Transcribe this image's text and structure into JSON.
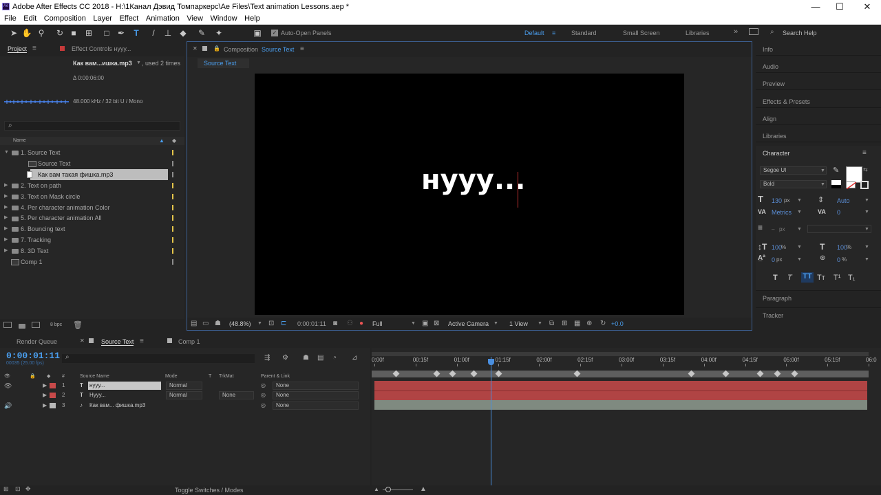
{
  "window": {
    "title": "Adobe After Effects CC 2018 - H:\\1Канал Дэвид Томпаркерс\\Ae Files\\Text animation Lessons.aep *",
    "app_icon": "Ae",
    "minimize": "—",
    "maximize": "☐",
    "close": "✕"
  },
  "menu": [
    "File",
    "Edit",
    "Composition",
    "Layer",
    "Effect",
    "Animation",
    "View",
    "Window",
    "Help"
  ],
  "toolbar": {
    "auto_open_panels": "Auto-Open Panels",
    "workspaces": [
      "Default",
      "Standard",
      "Small Screen",
      "Libraries"
    ],
    "active_workspace": "Default",
    "search_help": "Search Help",
    "more": "»"
  },
  "project_panel": {
    "tab_project": "Project",
    "tab_effect_controls": "Effect Controls нууу...",
    "file_name": "Как вам...ишка.mp3",
    "used": ", used 2 times",
    "duration": "Δ 0:00:06:00",
    "audio_info": "48.000 kHz / 32 bit U / Mono",
    "search_icon": "⌕",
    "column_name": "Name",
    "bpc": "8 bpc",
    "items": [
      {
        "label": "1. Source Text",
        "type": "folder",
        "open": true,
        "indent": 0
      },
      {
        "label": "Source Text",
        "type": "comp",
        "indent": 1
      },
      {
        "label": "Как вам такая фишка.mp3",
        "type": "audio",
        "indent": 1,
        "selected": true
      },
      {
        "label": "2. Text on path",
        "type": "folder",
        "indent": 0
      },
      {
        "label": "3. Text on Mask circle",
        "type": "folder",
        "indent": 0
      },
      {
        "label": "4. Per character animation Color",
        "type": "folder",
        "indent": 0
      },
      {
        "label": "5. Per character animation All",
        "type": "folder",
        "indent": 0
      },
      {
        "label": "6. Bouncing text",
        "type": "folder",
        "indent": 0
      },
      {
        "label": "7. Tracking",
        "type": "folder",
        "indent": 0
      },
      {
        "label": "8. 3D Text",
        "type": "folder",
        "indent": 0
      },
      {
        "label": "Comp 1",
        "type": "comp",
        "indent": 0
      }
    ]
  },
  "composition_panel": {
    "tab_prefix": "Composition",
    "tab_name": "Source Text",
    "subtab": "Source Text",
    "canvas_text": "нууу...",
    "zoom": "(48.8%)",
    "timecode": "0:00:01:11",
    "resolution": "Full",
    "camera": "Active Camera",
    "view": "1 View",
    "exposure": "+0.0"
  },
  "right_panel": {
    "tabs": [
      "Info",
      "Audio",
      "Preview",
      "Effects & Presets",
      "Align",
      "Libraries",
      "Character"
    ],
    "bottom_tabs": [
      "Paragraph",
      "Tracker"
    ],
    "font_family": "Segoe UI",
    "font_style": "Bold",
    "font_size": "130",
    "font_size_unit": "px",
    "leading": "Auto",
    "kerning": "Metrics",
    "tracking": "0",
    "stroke_width": "–",
    "stroke_unit": "px",
    "vert_scale": "100",
    "horiz_scale": "100",
    "baseline_shift": "0",
    "baseline_unit": "px",
    "tsume": "0",
    "percent": "%",
    "style_buttons": [
      "T",
      "T",
      "TT",
      "Tт",
      "T¹",
      "T₁"
    ],
    "fill_color": "#ffffff",
    "stroke_color": "#000000"
  },
  "timeline": {
    "tab_render_queue": "Render Queue",
    "tab_active": "Source Text",
    "tab_comp1": "Comp 1",
    "timecode": "0:00:01:11",
    "fps": "00035 (25.00 fps)",
    "col_source_name": "Source Name",
    "col_mode": "Mode",
    "col_t": "T",
    "col_trkmat": "TrkMat",
    "col_parent": "Parent & Link",
    "col_num": "#",
    "ruler": [
      "0:00f",
      "00:15f",
      "01:00f",
      "01:15f",
      "02:00f",
      "02:15f",
      "03:00f",
      "03:15f",
      "04:00f",
      "04:15f",
      "05:00f",
      "05:15f",
      "06:0"
    ],
    "layers": [
      {
        "num": "1",
        "type": "T",
        "name": "нууу...",
        "mode": "Normal",
        "trkmat": "",
        "parent": "None",
        "color": "#c84a4a",
        "selected": true
      },
      {
        "num": "2",
        "type": "T",
        "name": "Нууу...",
        "mode": "Normal",
        "trkmat": "None",
        "parent": "None",
        "color": "#c84a4a"
      },
      {
        "num": "3",
        "type": "♪",
        "name": "Как вам... фишка.mp3",
        "mode": "",
        "trkmat": "",
        "parent": "None",
        "color": "#b8b8b8"
      }
    ],
    "toggle_switches": "Toggle Switches / Modes",
    "current_time_fraction": 0.235,
    "keyframe_positions": [
      0.043,
      0.126,
      0.158,
      0.2,
      0.25,
      0.41,
      0.64,
      0.71,
      0.78,
      0.815,
      0.85
    ]
  }
}
